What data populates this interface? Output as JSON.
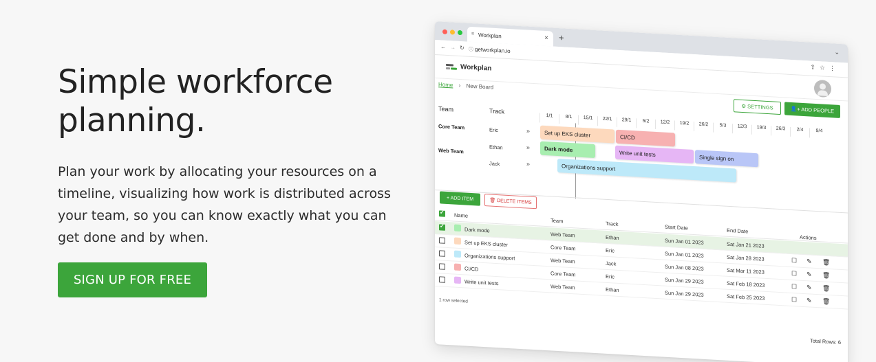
{
  "hero": {
    "headline": "Simple workforce planning.",
    "body": "Plan your work by allocating your resources on a timeline, visualizing how work is distributed across your team, so you can know exactly what you can get done and by when.",
    "cta": "SIGN UP FOR FREE"
  },
  "browser": {
    "tab_title": "Workplan",
    "url": "getworkplan.io"
  },
  "app": {
    "name": "Workplan",
    "breadcrumb": {
      "home": "Home",
      "separator": "›",
      "current": "New Board"
    },
    "settings_label": "SETTINGS",
    "add_people_label": "ADD PEOPLE",
    "accent": "#3ca53b"
  },
  "gantt": {
    "col_team": "Team",
    "col_track": "Track",
    "dates": [
      "1/1",
      "8/1",
      "15/1",
      "22/1",
      "29/1",
      "5/2",
      "12/2",
      "19/2",
      "26/2",
      "5/3",
      "12/3",
      "19/3",
      "26/3",
      "2/4",
      "9/4"
    ],
    "teams": [
      {
        "name": "Core Team",
        "tracks": [
          "Eric"
        ]
      },
      {
        "name": "Web Team",
        "tracks": [
          "Ethan",
          "Jack"
        ]
      }
    ],
    "expand_glyph": "»",
    "bars": [
      {
        "label": "Set up EKS cluster",
        "color": "#fdd9bd"
      },
      {
        "label": "CI/CD",
        "color": "#f7b1b1"
      },
      {
        "label": "Dark mode",
        "color": "#a8eeb0"
      },
      {
        "label": "Write unit tests",
        "color": "#e6b6f5"
      },
      {
        "label": "Single sign on",
        "color": "#b9c6f7"
      },
      {
        "label": "Organizations support",
        "color": "#bde9f9"
      }
    ]
  },
  "toolbar": {
    "add_item": "ADD ITEM",
    "delete_items": "DELETE ITEMS"
  },
  "table": {
    "headers": {
      "name": "Name",
      "team": "Team",
      "track": "Track",
      "start": "Start Date",
      "end": "End Date",
      "actions": "Actions"
    },
    "rows": [
      {
        "name": "Dark mode",
        "team": "Web Team",
        "track": "Ethan",
        "start": "Sun Jan 01 2023",
        "end": "Sat Jan 21 2023",
        "color": "#a8eeb0",
        "selected": true
      },
      {
        "name": "Set up EKS cluster",
        "team": "Core Team",
        "track": "Eric",
        "start": "Sun Jan 01 2023",
        "end": "Sat Jan 28 2023",
        "color": "#fdd9bd",
        "selected": false
      },
      {
        "name": "Organizations support",
        "team": "Web Team",
        "track": "Jack",
        "start": "Sun Jan 08 2023",
        "end": "Sat Mar 11 2023",
        "color": "#bde9f9",
        "selected": false
      },
      {
        "name": "CI/CD",
        "team": "Core Team",
        "track": "Eric",
        "start": "Sun Jan 29 2023",
        "end": "Sat Feb 18 2023",
        "color": "#f7b1b1",
        "selected": false
      },
      {
        "name": "Write unit tests",
        "team": "Web Team",
        "track": "Ethan",
        "start": "Sun Jan 29 2023",
        "end": "Sat Feb 25 2023",
        "color": "#e6b6f5",
        "selected": false
      }
    ],
    "footer_selected": "1 row selected",
    "footer_total": "Total Rows: 6"
  }
}
